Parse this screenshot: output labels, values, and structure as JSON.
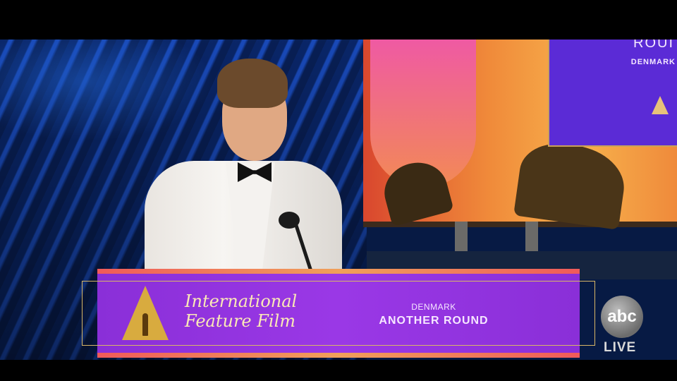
{
  "screen_panel": {
    "title_fragment": "ROUI",
    "country": "DENMARK"
  },
  "lower_third": {
    "category_line1": "International",
    "category_line2": "Feature Film",
    "country": "DENMARK",
    "film_title": "ANOTHER ROUND"
  },
  "broadcaster": {
    "logo_text": "abc",
    "live_label": "LIVE"
  },
  "colors": {
    "banner": "#9a38e6",
    "gold": "#d8ab3f",
    "curtain": "#1d56d8"
  }
}
